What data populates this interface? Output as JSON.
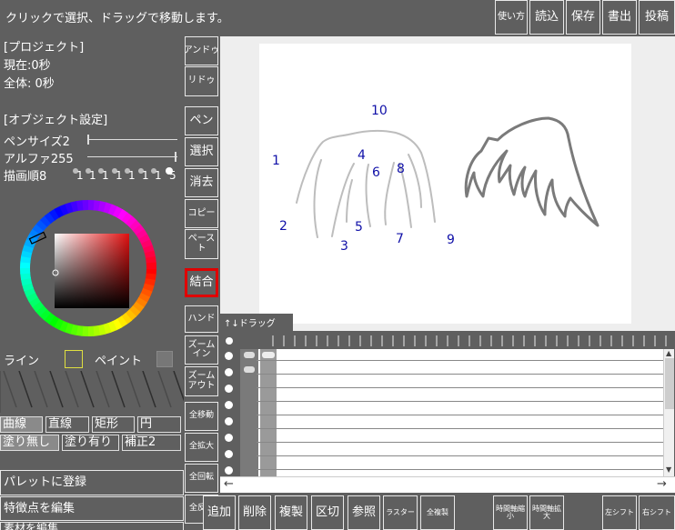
{
  "status": "クリックで選択、ドラッグで移動します。",
  "header": {
    "buttons": [
      "使い方",
      "読込",
      "保存",
      "書出",
      "投稿"
    ]
  },
  "project": {
    "title": "[プロジェクト]",
    "current": "現在:0秒",
    "total": "全体: 0秒"
  },
  "object": {
    "title": "[オブジェクト設定]",
    "pen_size": "ペンサイズ2",
    "alpha": "アルファ255",
    "order": "描画順8",
    "order_digits": [
      "1",
      "1",
      "1",
      "1",
      "1",
      "1",
      "1",
      "5"
    ]
  },
  "color": {
    "line_label": "ライン",
    "paint_label": "ペイント",
    "line_color": "#5f5f5f",
    "paint_color": "#6a6a6a"
  },
  "shapes": {
    "row1": [
      "曲線",
      "直線",
      "矩形",
      "円"
    ],
    "row2": [
      "塗り無し",
      "塗り有り",
      "補正2"
    ]
  },
  "left_menu": [
    "パレットに登録",
    "特徴点を編集",
    "素材を編集"
  ],
  "tools": [
    "アンドゥ",
    "リドゥ",
    "ペン",
    "選択",
    "消去",
    "コピー",
    "ペースト",
    "結合",
    "ハンド",
    "ズームイン",
    "ズームアウト",
    "全移動",
    "全拡大",
    "全回転",
    "全反転"
  ],
  "labels": [
    "1",
    "2",
    "3",
    "4",
    "5",
    "6",
    "7",
    "8",
    "9",
    "10"
  ],
  "timeline": {
    "tab": "↑↓ドラッグ",
    "arrow_left": "←",
    "arrow_right": "→"
  },
  "bottom": [
    "追加",
    "削除",
    "複製",
    "区切",
    "参照",
    "ラスター",
    "全複製",
    "時間軸縮小",
    "時間軸拡大",
    "左シフト",
    "右シフト"
  ]
}
